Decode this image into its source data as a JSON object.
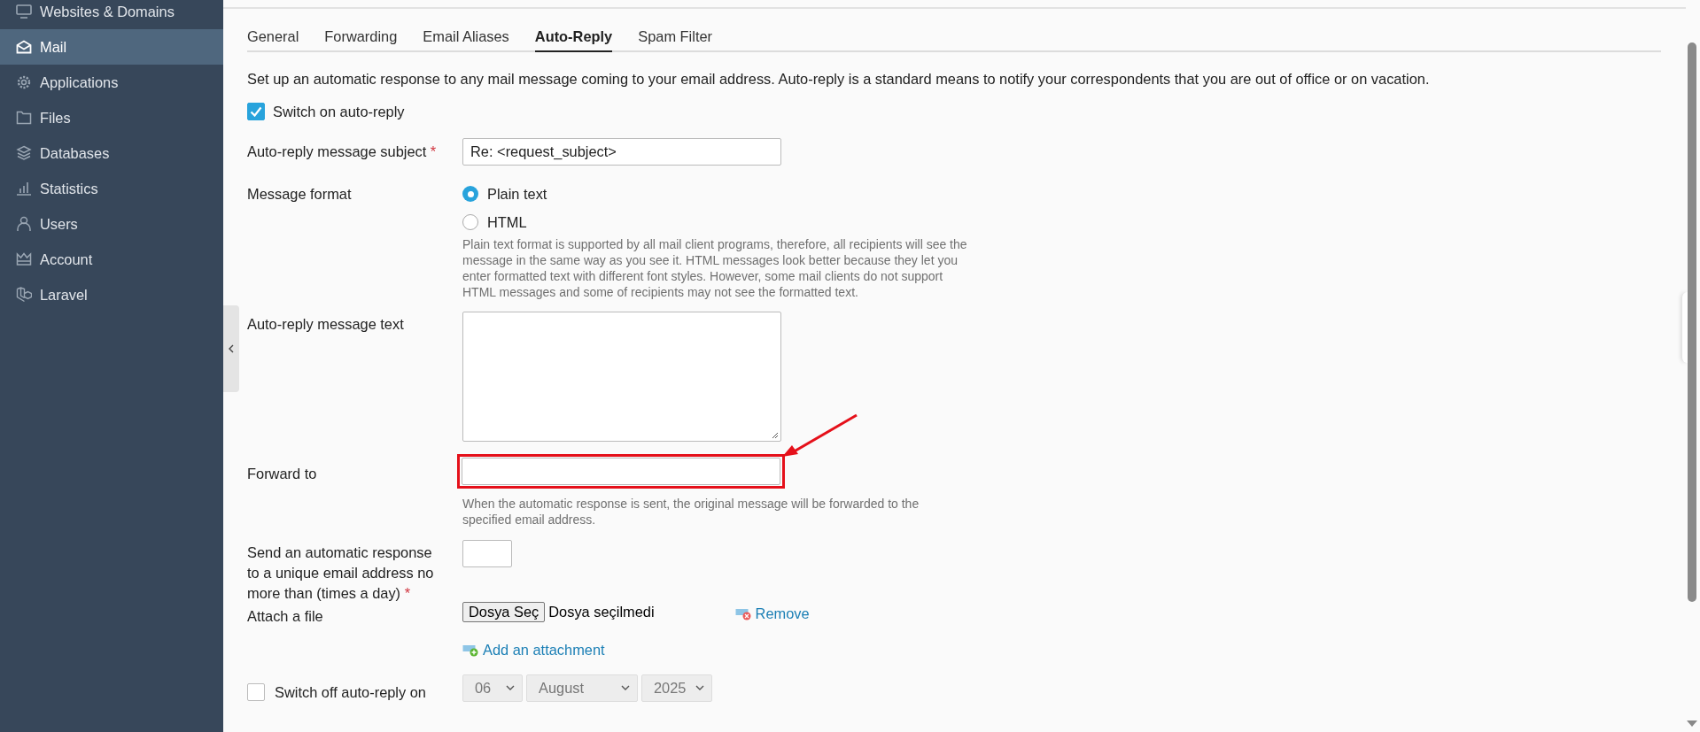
{
  "sidebar": {
    "items": [
      {
        "label": "Websites & Domains",
        "selected": false
      },
      {
        "label": "Mail",
        "selected": true
      },
      {
        "label": "Applications",
        "selected": false
      },
      {
        "label": "Files",
        "selected": false
      },
      {
        "label": "Databases",
        "selected": false
      },
      {
        "label": "Statistics",
        "selected": false
      },
      {
        "label": "Users",
        "selected": false
      },
      {
        "label": "Account",
        "selected": false
      },
      {
        "label": "Laravel",
        "selected": false
      }
    ]
  },
  "tabs": [
    {
      "label": "General",
      "selected": false
    },
    {
      "label": "Forwarding",
      "selected": false
    },
    {
      "label": "Email Aliases",
      "selected": false
    },
    {
      "label": "Auto-Reply",
      "selected": true
    },
    {
      "label": "Spam Filter",
      "selected": false
    }
  ],
  "description": "Set up an automatic response to any mail message coming to your email address. Auto-reply is a standard means to notify your correspondents that you are out of office or on vacation.",
  "auto_reply_switch": {
    "label": "Switch on auto-reply",
    "checked": true
  },
  "form": {
    "subject": {
      "label": "Auto-reply message subject",
      "required_mark": "*",
      "value": "Re: <request_subject>"
    },
    "message_format": {
      "label": "Message format",
      "options": [
        {
          "label": "Plain text",
          "selected": true
        },
        {
          "label": "HTML",
          "selected": false
        }
      ],
      "hint": "Plain text format is supported by all mail client programs, therefore, all recipients will see the message in the same way as you see it. HTML messages look better because they let you enter formatted text with different font styles. However, some mail clients do not support HTML messages and some of recipients may not see the formatted text."
    },
    "message_text": {
      "label": "Auto-reply message text"
    },
    "forward_to": {
      "label": "Forward to",
      "highlighted": true,
      "hint": "When the automatic response is sent, the original message will be forwarded to the specified email address."
    },
    "send_limit": {
      "label": "Send an automatic response to a unique email address no more than (times a day)",
      "required_mark": "*"
    },
    "attach": {
      "label": "Attach a file",
      "button": "Dosya Seç",
      "status": "Dosya seçilmedi",
      "remove": "Remove",
      "add": "Add an attachment"
    },
    "switch_off": {
      "label": "Switch off auto-reply on",
      "checked": false,
      "disabled": true,
      "day": "06",
      "month": "August",
      "year": "2025"
    }
  }
}
